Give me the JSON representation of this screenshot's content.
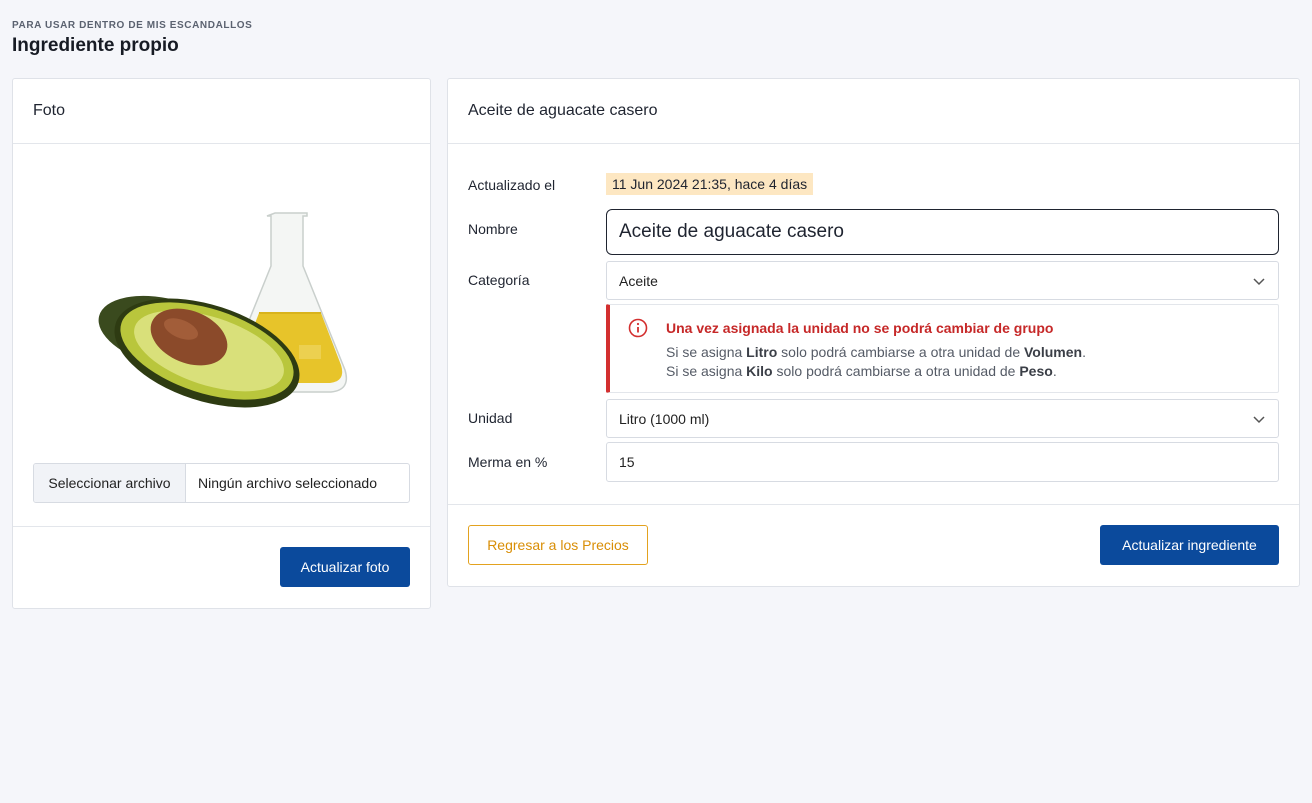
{
  "header": {
    "eyebrow": "PARA USAR DENTRO DE MIS ESCANDALLOS",
    "title": "Ingrediente propio"
  },
  "photo_card": {
    "title": "Foto",
    "image_icon": "avocado-oil-photo",
    "file_button_label": "Seleccionar archivo",
    "file_status": "Ningún archivo seleccionado",
    "update_button_label": "Actualizar foto"
  },
  "ingredient_card": {
    "title": "Aceite de aguacate casero",
    "updated_label": "Actualizado el",
    "updated_value": "11 Jun 2024 21:35, hace 4 días",
    "name_label": "Nombre",
    "name_value": "Aceite de aguacate casero",
    "category_label": "Categoría",
    "category_value": "Aceite",
    "alert": {
      "title": "Una vez asignada la unidad no se podrá cambiar de grupo",
      "line1_pre": "Si se asigna ",
      "line1_unit": "Litro",
      "line1_mid": " solo podrá cambiarse a otra unidad de ",
      "line1_group": "Volumen",
      "line1_end": ".",
      "line2_pre": "Si se asigna ",
      "line2_unit": "Kilo",
      "line2_mid": " solo podrá cambiarse a otra unidad de ",
      "line2_group": "Peso",
      "line2_end": "."
    },
    "unit_label": "Unidad",
    "unit_value": "Litro (1000 ml)",
    "waste_label": "Merma en %",
    "waste_value": "15",
    "back_button_label": "Regresar a los Precios",
    "update_button_label": "Actualizar ingrediente"
  },
  "colors": {
    "primary": "#0b4a9c",
    "warning_outline": "#e3a21f",
    "alert_red": "#d32f2f",
    "badge_bg": "#fde7c2"
  }
}
